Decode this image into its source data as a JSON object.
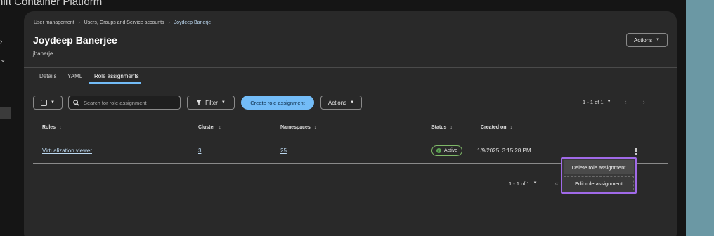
{
  "app": {
    "title": "hift Container Platform"
  },
  "nav": {
    "chevrons": [
      "›",
      "⌄"
    ]
  },
  "breadcrumb": {
    "items": [
      "User management",
      "Users, Groups and Service accounts",
      "Joydeep Banerje"
    ],
    "separator": "›"
  },
  "header": {
    "title": "Joydeep Banerjee",
    "subtitle": "jbanerje",
    "actions_label": "Actions"
  },
  "tabs": [
    {
      "label": "Details",
      "active": false
    },
    {
      "label": "YAML",
      "active": false
    },
    {
      "label": "Role assignments",
      "active": true
    }
  ],
  "toolbar": {
    "search_placeholder": "Search for role assignment",
    "filter_label": "Filter",
    "create_label": "Create role assignment",
    "actions_label": "Actions",
    "pagination": "1 - 1 of 1"
  },
  "table": {
    "columns": [
      "Roles",
      "Cluster",
      "Namespaces",
      "Status",
      "Created on"
    ],
    "rows": [
      {
        "role": "Virtualization viewer",
        "cluster": "3",
        "namespaces": "25",
        "status": "Active",
        "created": "1/9/2025, 3:15:28 PM"
      }
    ]
  },
  "row_menu": {
    "items": [
      "Delete role assignment",
      "Edit role assignment"
    ]
  },
  "pagination_bottom": {
    "label": "1 - 1 of 1"
  },
  "colors": {
    "accent": "#73bcf7",
    "status_active": "#5ba352",
    "highlight": "#a06ae8",
    "side_panel": "#6b98a4"
  },
  "icons": {
    "sort": "sort-icon",
    "kebab": "kebab-icon",
    "search": "search-icon",
    "filter": "filter-icon",
    "check": "check-circle-icon",
    "caret": "caret-down-icon"
  }
}
